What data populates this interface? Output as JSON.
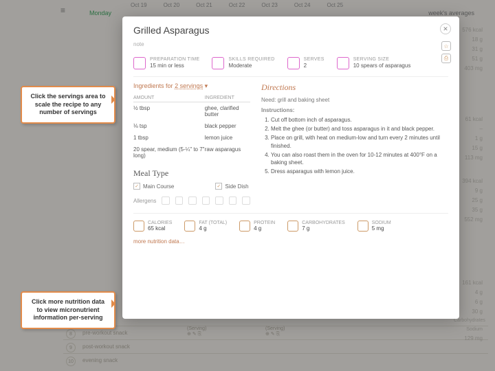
{
  "calendar": {
    "dates": [
      "Oct 19",
      "Oct 20",
      "Oct 21",
      "Oct 22",
      "Oct 23",
      "Oct 24",
      "Oct 25"
    ],
    "day_label": "Monday",
    "week_avg_label": "week's averages"
  },
  "modal": {
    "title": "Grilled Asparagus",
    "note": "note",
    "meta": {
      "prep_label": "PREPARATION TIME",
      "prep_val": "15 min or less",
      "skill_label": "SKILLS REQUIRED",
      "skill_val": "Moderate",
      "serves_label": "SERVES",
      "serves_val": "2",
      "size_label": "SERVING SIZE",
      "size_val": "10 spears of asparagus"
    },
    "ingredients": {
      "header_prefix": "Ingredients for",
      "servings": "2 servings",
      "col_amount": "AMOUNT",
      "col_ingredient": "INGREDIENT",
      "rows": [
        {
          "amt": "½ tbsp",
          "ing": "ghee, clarified butter"
        },
        {
          "amt": "⅛ tsp",
          "ing": "black pepper"
        },
        {
          "amt": "1 tbsp",
          "ing": "lemon juice"
        },
        {
          "amt": "20 spear, medium (5-¼\" to 7\" long)",
          "ing": "raw asparagus"
        }
      ]
    },
    "directions": {
      "header": "Directions",
      "need": "Need: grill and baking sheet",
      "instr_label": "Instructions:",
      "steps": [
        "Cut off bottom inch of asparagus.",
        "Melt the ghee (or butter) and toss asparagus in it and black pepper.",
        "Place on grill, with heat on medium-low and turn every 2 minutes until finished.",
        "You can also roast them in the oven for 10-12 minutes at 400°F on a baking sheet.",
        "Dress asparagus with lemon juice."
      ]
    },
    "meal_type": {
      "header": "Meal Type",
      "main": "Main Course",
      "side": "Side Dish"
    },
    "allergens_label": "Allergens",
    "nutrition": {
      "cal_label": "CALORIES",
      "cal_val": "65 kcal",
      "fat_label": "FAT (TOTAL)",
      "fat_val": "4 g",
      "pro_label": "PROTEIN",
      "pro_val": "4 g",
      "carb_label": "CARBOHYDRATES",
      "carb_val": "7 g",
      "sod_label": "SODIUM",
      "sod_val": "5 mg"
    },
    "more_label": "more nutrition data…"
  },
  "callouts": {
    "servings": "Click the servings area to scale the recipe to any number of servings",
    "nutrition": "Click more nutrition data to view micronutrient information per-serving"
  },
  "right_col": {
    "r1": "576 kcal",
    "r2": "18 g",
    "r3": "31 g",
    "r4": "51 g",
    "r5": "403 mg",
    "b1": "61 kcal",
    "b2": "–",
    "b3": "1 g",
    "b4": "15 g",
    "b5": "113 mg",
    "c1": "394 kcal",
    "c2": "9 g",
    "c3": "25 g",
    "c4": "35 g",
    "c5": "552 mg",
    "d1": "161 kcal",
    "d2": "4 g",
    "d3": "6 g",
    "d4": "30 g",
    "d5": "129 mg",
    "lbl1": "Carbohydrates",
    "lbl2": "Sodium"
  },
  "bottom": {
    "serving_lbl": "(Serving)",
    "pre": "pre-workout snack",
    "post": "post-workout snack",
    "eve": "evening snack"
  }
}
